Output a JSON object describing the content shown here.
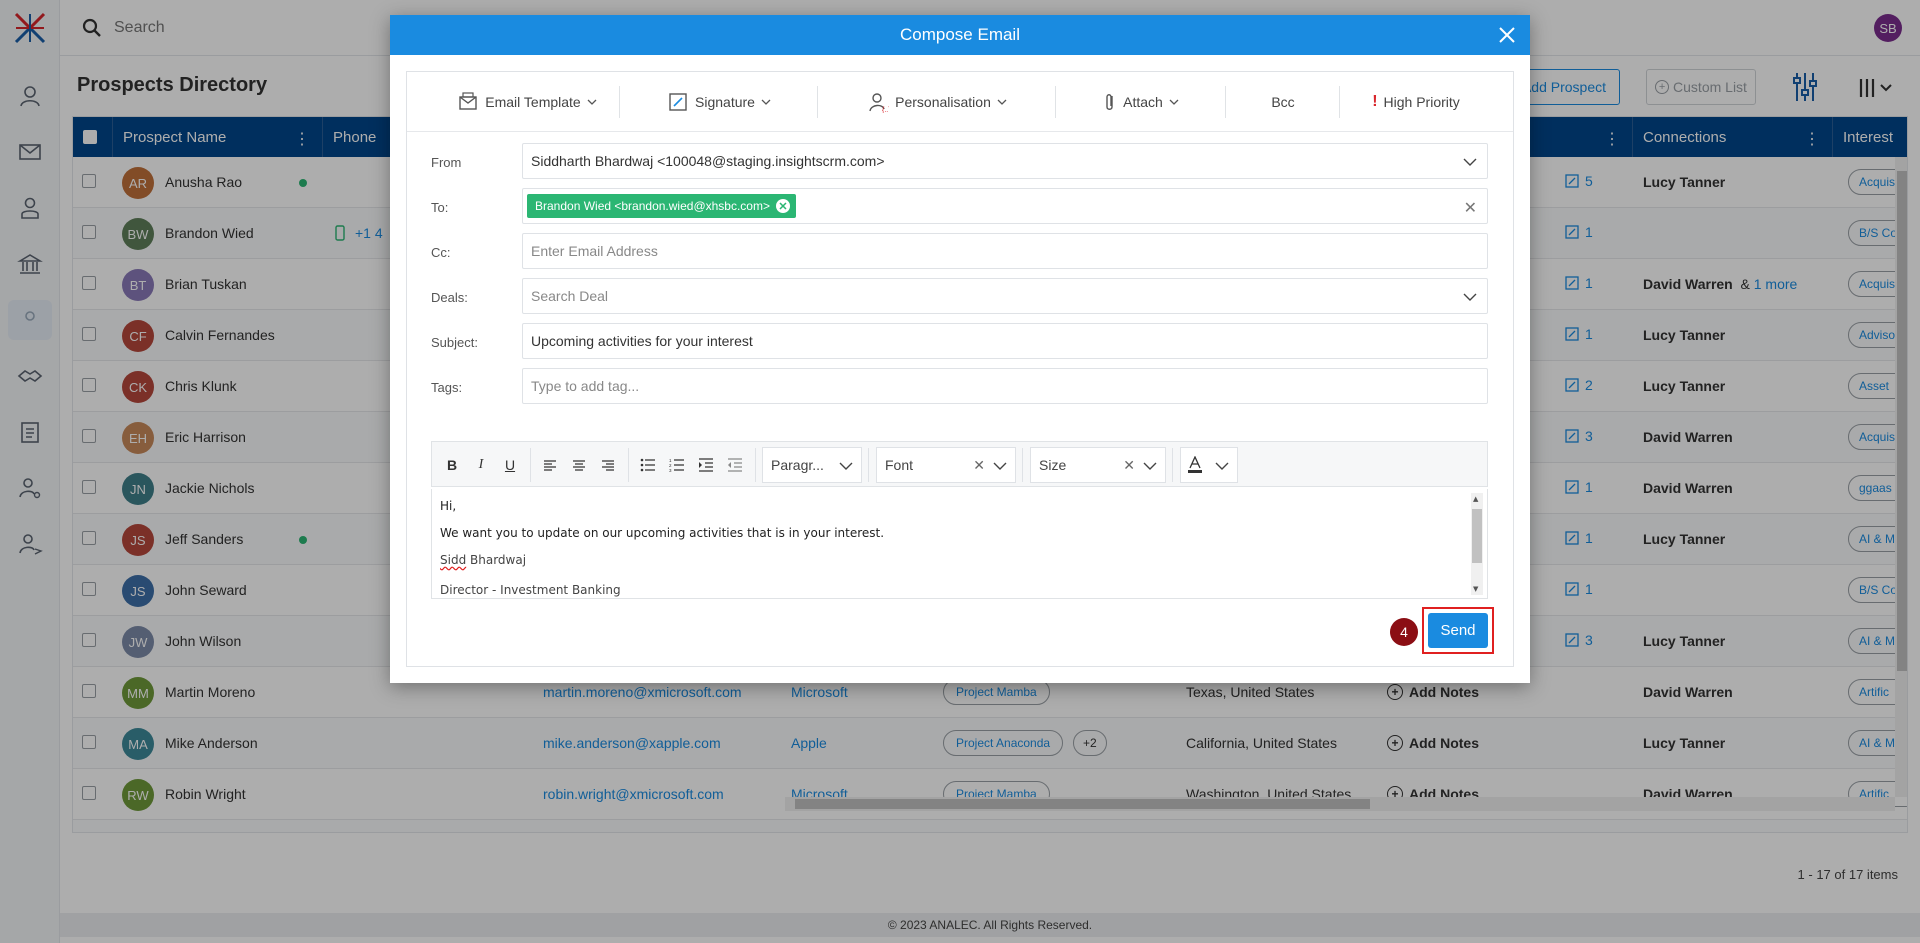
{
  "topbar": {
    "search_placeholder": "Search",
    "avatar_initials": "SB"
  },
  "page": {
    "title": "Prospects Directory",
    "add_prospect": "Add Prospect",
    "custom_list": "Custom List"
  },
  "table": {
    "headers": {
      "name": "Prospect Name",
      "phone": "Phone",
      "connections": "Connections",
      "interest": "Interest"
    },
    "rows": [
      {
        "initials": "AR",
        "name": "Anusha Rao",
        "color": "#c0703a",
        "online": true,
        "notes": "5",
        "conn": "Lucy Tanner",
        "more": "",
        "interest": "Acquis"
      },
      {
        "initials": "BW",
        "name": "Brandon Wied",
        "color": "#5f7f5a",
        "online": false,
        "phone": "+1 4",
        "notes": "1",
        "conn": "",
        "more": "",
        "interest": "B/S Co"
      },
      {
        "initials": "BT",
        "name": "Brian Tuskan",
        "color": "#8a7ab8",
        "online": false,
        "notes": "1",
        "conn": "David Warren",
        "more": "1 more",
        "interest": "Acquis"
      },
      {
        "initials": "CF",
        "name": "Calvin Fernandes",
        "color": "#b5483c",
        "online": false,
        "notes": "1",
        "conn": "Lucy Tanner",
        "more": "",
        "interest": "Adviso"
      },
      {
        "initials": "CK",
        "name": "Chris Klunk",
        "color": "#b5483c",
        "online": false,
        "notes": "2",
        "conn": "Lucy Tanner",
        "more": "",
        "interest": "Asset"
      },
      {
        "initials": "EH",
        "name": "Eric Harrison",
        "color": "#c88a5a",
        "online": false,
        "notes": "3",
        "conn": "David Warren",
        "more": "",
        "interest": "Acquis"
      },
      {
        "initials": "JN",
        "name": "Jackie Nichols",
        "color": "#3f7f8a",
        "online": false,
        "notes": "1",
        "conn": "David Warren",
        "more": "",
        "interest": "ggaas"
      },
      {
        "initials": "JS",
        "name": "Jeff Sanders",
        "color": "#b5483c",
        "online": true,
        "notes": "1",
        "conn": "Lucy Tanner",
        "more": "",
        "interest": "AI & M"
      },
      {
        "initials": "JS",
        "name": "John Seward",
        "color": "#3d6fa8",
        "online": false,
        "notes": "1",
        "conn": "",
        "more": "",
        "interest": "B/S Co"
      },
      {
        "initials": "JW",
        "name": "John Wilson",
        "color": "#7d8ba8",
        "online": false,
        "notes": "3",
        "conn": "Lucy Tanner",
        "more": "",
        "interest": "AI & M"
      },
      {
        "initials": "MM",
        "name": "Martin Moreno",
        "color": "#6f9a3a",
        "online": false,
        "email": "martin.moreno@xmicrosoft.com",
        "company": "Microsoft",
        "deal": "Project Mamba",
        "extra": "",
        "location": "Texas, United States",
        "add_notes": "Add Notes",
        "conn": "David Warren",
        "more": "",
        "interest": "Artific"
      },
      {
        "initials": "MA",
        "name": "Mike Anderson",
        "color": "#3d8a9a",
        "online": false,
        "email": "mike.anderson@xapple.com",
        "company": "Apple",
        "deal": "Project Anaconda",
        "extra": "+2",
        "location": "California, United States",
        "add_notes": "Add Notes",
        "conn": "Lucy Tanner",
        "more": "",
        "interest": "AI & M"
      },
      {
        "initials": "RW",
        "name": "Robin Wright",
        "color": "#6f9a3a",
        "online": false,
        "email": "robin.wright@xmicrosoft.com",
        "company": "Microsoft",
        "deal": "Project Mamba",
        "extra": "",
        "location": "Washington, United States",
        "add_notes": "Add Notes",
        "conn": "David Warren",
        "more": "",
        "interest": "Artific"
      }
    ],
    "connector": "&",
    "pager": "1 - 17 of 17 items"
  },
  "footer": "© 2023 ANALEC. All Rights Reserved.",
  "modal": {
    "title": "Compose Email",
    "toolbar": {
      "template": "Email Template",
      "signature": "Signature",
      "personalisation": "Personalisation",
      "attach": "Attach",
      "bcc": "Bcc",
      "priority": "High Priority"
    },
    "fields": {
      "from_label": "From",
      "from_value": "Siddharth Bhardwaj <100048@staging.insightscrm.com>",
      "to_label": "To:",
      "to_chip": "Brandon Wied <brandon.wied@xhsbc.com>",
      "cc_label": "Cc:",
      "cc_placeholder": "Enter Email Address",
      "deals_label": "Deals:",
      "deals_placeholder": "Search Deal",
      "subject_label": "Subject:",
      "subject_value": "Upcoming activities for your interest",
      "tags_label": "Tags:",
      "tags_placeholder": "Type to add tag..."
    },
    "editor": {
      "paragraph": "Paragr...",
      "font": "Font",
      "size": "Size",
      "line1": "Hi,",
      "line2": "We want you to update on our upcoming activities that is in your interest.",
      "sig_first": "Sidd",
      "sig_rest": " Bhardwaj",
      "line4": "Director - Investment Banking"
    },
    "step": "4",
    "send": "Send"
  }
}
